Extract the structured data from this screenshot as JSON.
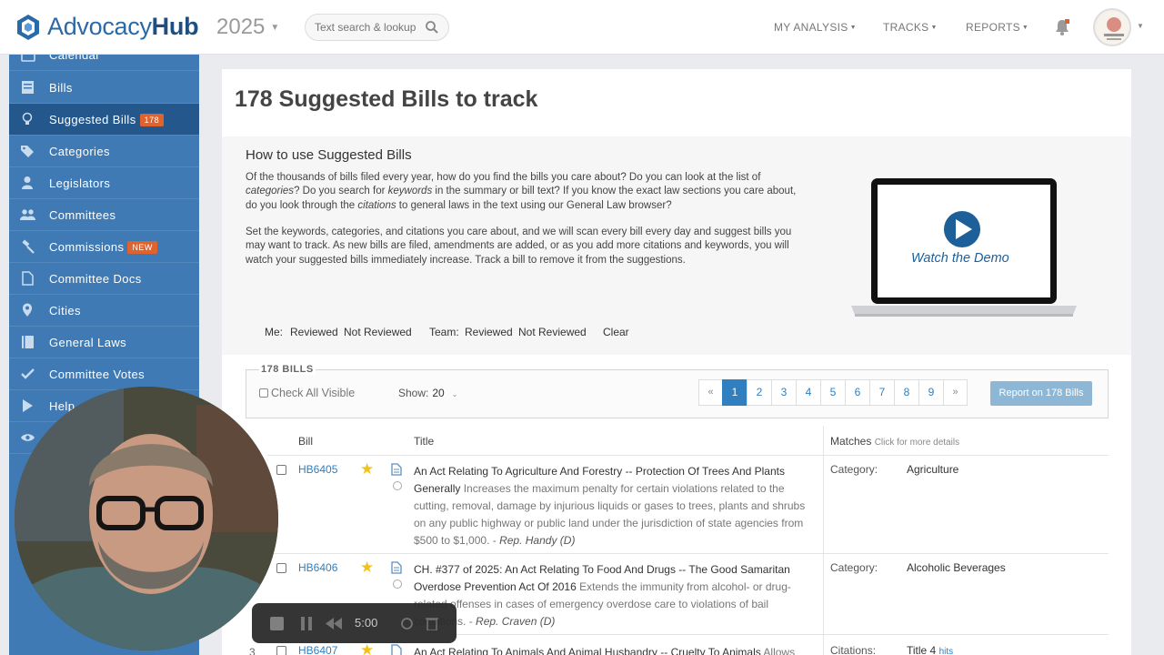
{
  "header": {
    "brand_light": "Advocacy",
    "brand_bold": "Hub",
    "year": "2025",
    "search_placeholder": "Text search & lookup",
    "menus": [
      "MY ANALYSIS",
      "TRACKS",
      "REPORTS"
    ]
  },
  "sidebar": {
    "items": [
      {
        "label": "Calendar",
        "icon": "calendar-icon"
      },
      {
        "label": "Bills",
        "icon": "bills-icon"
      },
      {
        "label": "Suggested Bills",
        "icon": "lightbulb-icon",
        "badge": "178",
        "active": true
      },
      {
        "label": "Categories",
        "icon": "tags-icon"
      },
      {
        "label": "Legislators",
        "icon": "user-icon"
      },
      {
        "label": "Committees",
        "icon": "users-icon"
      },
      {
        "label": "Commissions",
        "icon": "gavel-icon",
        "badge": "NEW"
      },
      {
        "label": "Committee Docs",
        "icon": "document-icon"
      },
      {
        "label": "Cities",
        "icon": "map-pin-icon"
      },
      {
        "label": "General Laws",
        "icon": "book-icon"
      },
      {
        "label": "Committee Votes",
        "icon": "check-icon"
      },
      {
        "label": "Help",
        "icon": "play-icon"
      }
    ]
  },
  "main": {
    "title": "178 Suggested Bills to track",
    "howto": {
      "heading": "How to use Suggested Bills",
      "p1": [
        {
          "t": "Of the thousands of bills filed every year, how do you find the bills you care about? Do you can look at the list of "
        },
        {
          "t": "categories",
          "em": true
        },
        {
          "t": "? Do you search for "
        },
        {
          "t": "keywords",
          "em": true
        },
        {
          "t": " in the summary or bill text? If you know the exact law sections you care about, do you look through the "
        },
        {
          "t": "citations",
          "em": true
        },
        {
          "t": " to general laws in the text using our General Law browser?"
        }
      ],
      "p2": "Set the keywords, categories, and citations you care about, and we will scan every bill every day and suggest bills you may want to track. As new bills are filed, amendments are added, or as you add more citations and keywords, you will watch your suggested bills immediately increase. Track a bill to remove it from the suggestions.",
      "demo_label": "Watch the Demo"
    },
    "filters": {
      "me_label": "Me:",
      "me_reviewed": "Reviewed",
      "me_not_reviewed": "Not Reviewed",
      "team_label": "Team:",
      "team_reviewed": "Reviewed",
      "team_not_reviewed": "Not Reviewed",
      "clear": "Clear"
    },
    "bills_box": {
      "heading": "178 BILLS",
      "check_all": "Check All Visible",
      "show_label": "Show:",
      "show_value": "20",
      "pages": [
        "«",
        "1",
        "2",
        "3",
        "4",
        "5",
        "6",
        "7",
        "8",
        "9",
        "»"
      ],
      "current_page": "1",
      "report_button": "Report on 178 Bills"
    },
    "table": {
      "col_bill": "Bill",
      "col_title": "Title",
      "col_matches": "Matches",
      "col_matches_hint": "Click for more details",
      "rows": [
        {
          "num": "",
          "bill": "HB6405",
          "title": "An Act Relating To Agriculture And Forestry -- Protection Of Trees And Plants Generally",
          "summary": " Increases the maximum penalty for certain violations related to the cutting, removal, damage by injurious liquids or gases to trees, plants and shrubs on any public highway or public land under the jurisdiction of state agencies from $500 to $1,000. -",
          "rep": " Rep. Handy (D)",
          "match_label": "Category:",
          "match_value": "Agriculture",
          "match_extra": ""
        },
        {
          "num": "",
          "bill": "HB6406",
          "title": "CH. #377 of 2025: An Act Relating To Food And Drugs -- The Good Samaritan Overdose Prevention Act Of 2016",
          "summary": " Extends the immunity from alcohol- or drug-related offenses in cases of emergency overdose care to violations of bail conditions. -",
          "rep": " Rep. Craven (D)",
          "match_label": "Category:",
          "match_value": "Alcoholic Beverages",
          "match_extra": ""
        },
        {
          "num": "3",
          "bill": "HB6407",
          "title": "An Act Relating To Animals And Animal Husbandry -- Cruelty To Animals",
          "summary": " Allows animal",
          "rep": "",
          "match_label": "Citations:",
          "match_value": "Title 4 ",
          "match_extra": "hits"
        }
      ]
    }
  },
  "recorder": {
    "time": "5:00"
  }
}
